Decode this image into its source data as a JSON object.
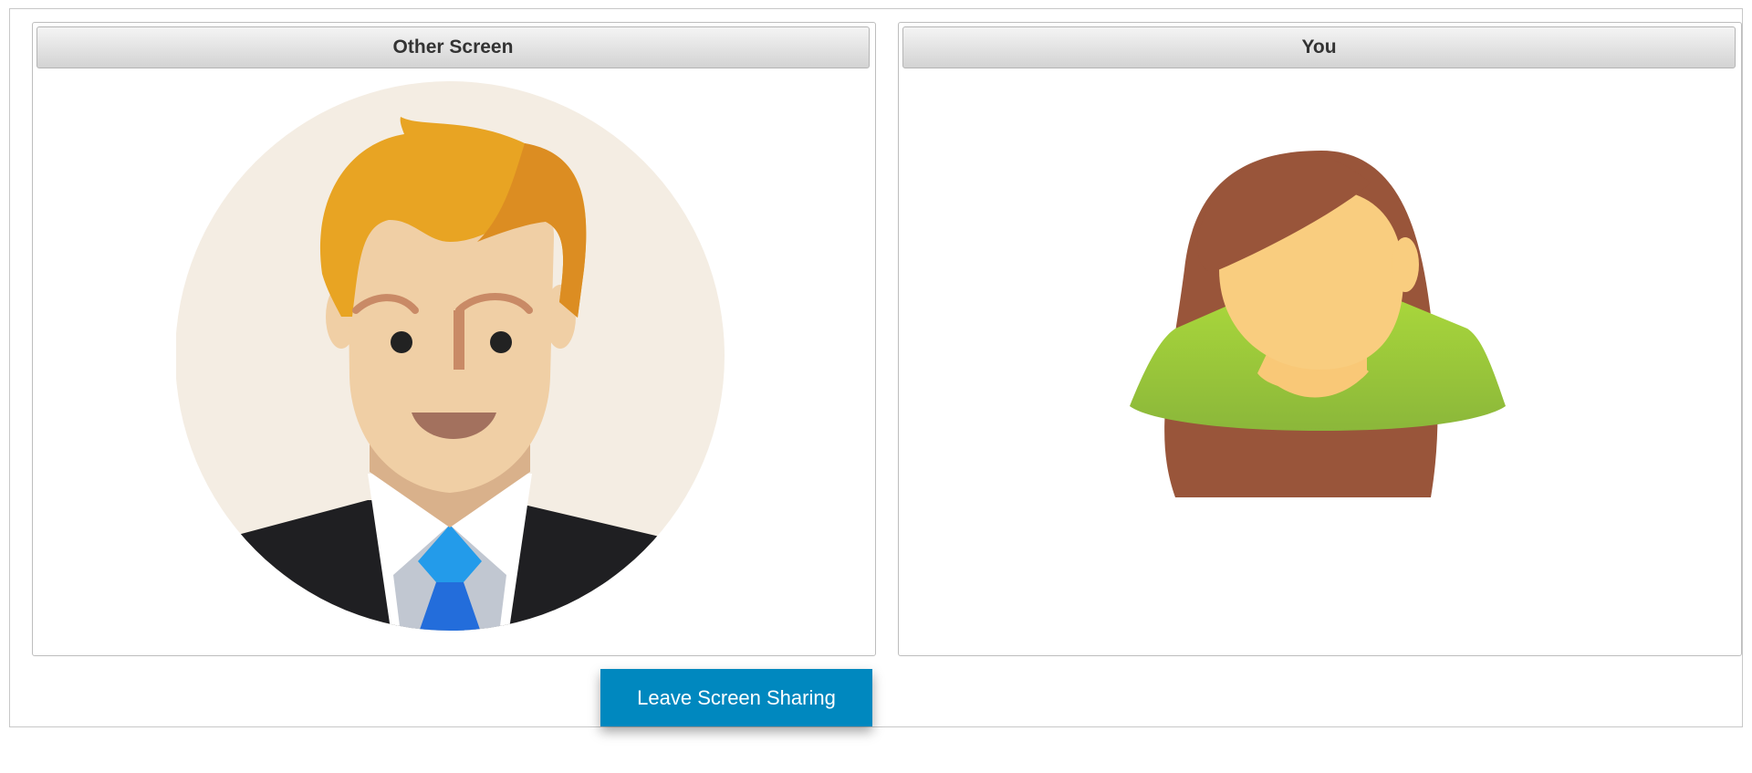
{
  "panels": {
    "other": {
      "title": "Other Screen",
      "avatar_icon": "male-avatar-icon"
    },
    "you": {
      "title": "You",
      "avatar_icon": "female-avatar-icon"
    }
  },
  "actions": {
    "leave_label": "Leave Screen Sharing",
    "leave_color": "#0088bf"
  }
}
